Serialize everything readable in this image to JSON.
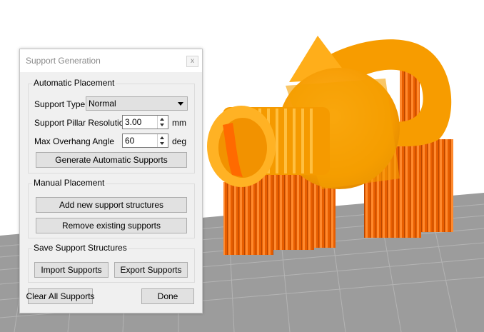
{
  "dialog": {
    "title": "Support Generation",
    "close_label": "x",
    "automatic": {
      "heading": "Automatic Placement",
      "support_type_label": "Support Type",
      "support_type_value": "Normal",
      "pillar_res_label": "Support Pillar Resolution",
      "pillar_res_value": "3.00",
      "pillar_res_unit": "mm",
      "overhang_label": "Max Overhang Angle",
      "overhang_value": "60",
      "overhang_unit": "deg",
      "generate_button": "Generate Automatic Supports"
    },
    "manual": {
      "heading": "Manual Placement",
      "add_button": "Add new support structures",
      "remove_button": "Remove existing supports"
    },
    "save": {
      "heading": "Save Support Structures",
      "import_button": "Import Supports",
      "export_button": "Export Supports"
    },
    "clear_button": "Clear All Supports",
    "done_button": "Done"
  },
  "colors": {
    "model": "#ffa000",
    "supports": "#ff6600",
    "bed": "#9a9a9a",
    "background": "#ffffff"
  }
}
